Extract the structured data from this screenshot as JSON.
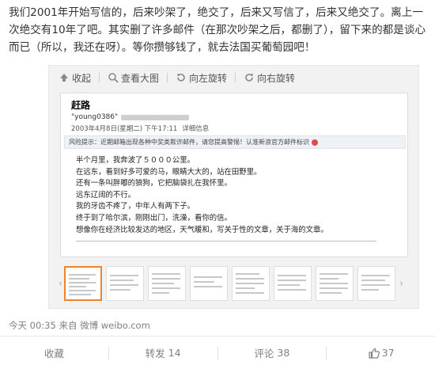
{
  "post": {
    "text": "我们2001年开始写信的，后来吵架了，绝交了，后来又写信了，后来又绝交了。离上一次绝交有10年了吧。其实删了许多邮件（在那次吵架之后，都删了），留下来的都是谈心而已（所以，我还在呀）。等你攒够钱了，就去法国买葡萄园吧！"
  },
  "toolbar": {
    "collapse": "收起",
    "view_large": "查看大图",
    "rotate_left": "向左旋转",
    "rotate_right": "向右旋转"
  },
  "email": {
    "from": "赶路",
    "addr": "\"young0386\"",
    "date": "2003年4月8日(星期二) 下午17:11",
    "detail": "详细信息",
    "warning": "风险提示：近期邮箱出现各种中奖类欺诈邮件，请您提高警惕！认准新浪官方邮件标识",
    "lines": [
      "半个月里，我奔波了５０００公里。",
      "在远东，看到好多可爱的马，眼睛大大的，站在田野里。",
      "还有一条叫胖嘟的狼狗，它把脑袋扎在我怀里。",
      "远东辽阔的不行。",
      "我的牙齿不疼了，中年人有两下子。",
      "终于到了哈尔滨，刚刚出门，洗澡，看你的信。",
      "想像你在经济比较发达的地区，天气暖和，写关于性的文章，关于海的文章。"
    ]
  },
  "thumbs": {
    "count": 8,
    "active_index": 0
  },
  "meta": {
    "time": "今天 00:35",
    "from_label": "来自",
    "source": "微博 weibo.com"
  },
  "actions": {
    "favorite": "收藏",
    "repost_label": "转发",
    "repost_count": "14",
    "comment_label": "评论",
    "comment_count": "38",
    "like_count": "37"
  },
  "colors": {
    "active_thumb_border": "#f0842c",
    "muted_text": "#808080"
  }
}
